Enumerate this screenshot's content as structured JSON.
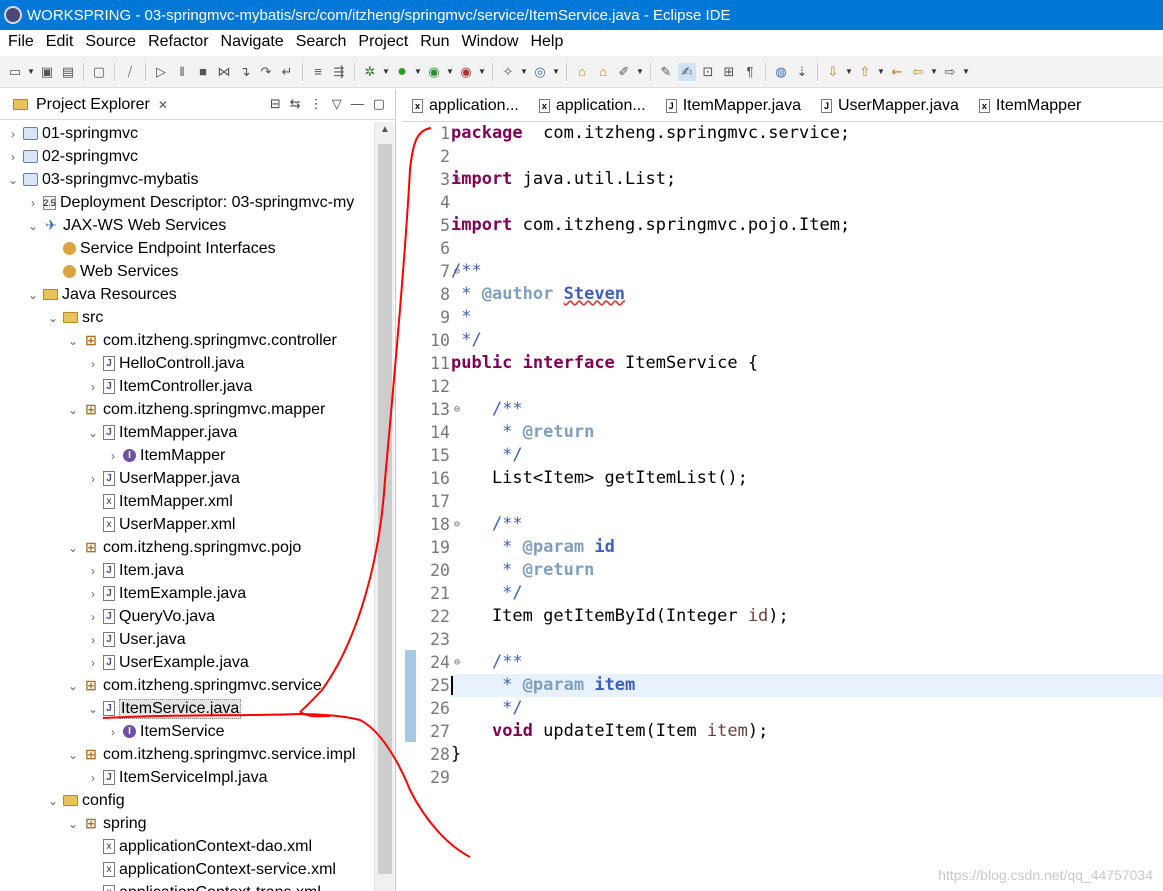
{
  "window": {
    "title": "WORKSPRING - 03-springmvc-mybatis/src/com/itzheng/springmvc/service/ItemService.java - Eclipse IDE"
  },
  "menubar": {
    "items": [
      "File",
      "Edit",
      "Source",
      "Refactor",
      "Navigate",
      "Search",
      "Project",
      "Run",
      "Window",
      "Help"
    ]
  },
  "project_explorer": {
    "title": "Project Explorer",
    "tree": [
      {
        "label": "01-springmvc",
        "icon": "project-icon",
        "twisty": "›",
        "indent": 0
      },
      {
        "label": "02-springmvc",
        "icon": "project-icon",
        "twisty": "›",
        "indent": 0
      },
      {
        "label": "03-springmvc-mybatis",
        "icon": "project-icon",
        "twisty": "⌄",
        "indent": 0
      },
      {
        "label": "Deployment Descriptor: 03-springmvc-my",
        "icon": "deployment-descriptor-icon",
        "twisty": "›",
        "indent": 1
      },
      {
        "label": "JAX-WS Web Services",
        "icon": "web-services-icon",
        "twisty": "⌄",
        "indent": 1
      },
      {
        "label": "Service Endpoint Interfaces",
        "icon": "endpoint-icon",
        "twisty": "",
        "indent": 2
      },
      {
        "label": "Web Services",
        "icon": "web-service-icon",
        "twisty": "",
        "indent": 2
      },
      {
        "label": "Java Resources",
        "icon": "java-resources-icon",
        "twisty": "⌄",
        "indent": 1
      },
      {
        "label": "src",
        "icon": "source-folder-icon",
        "twisty": "⌄",
        "indent": 2
      },
      {
        "label": "com.itzheng.springmvc.controller",
        "icon": "package-icon",
        "twisty": "⌄",
        "indent": 3
      },
      {
        "label": "HelloControll.java",
        "icon": "java-file-icon",
        "twisty": "›",
        "indent": 4
      },
      {
        "label": "ItemController.java",
        "icon": "java-file-icon",
        "twisty": "›",
        "indent": 4
      },
      {
        "label": "com.itzheng.springmvc.mapper",
        "icon": "package-icon",
        "twisty": "⌄",
        "indent": 3
      },
      {
        "label": "ItemMapper.java",
        "icon": "java-interface-file-icon",
        "twisty": "⌄",
        "indent": 4
      },
      {
        "label": "ItemMapper",
        "icon": "interface-icon",
        "twisty": "›",
        "indent": 5
      },
      {
        "label": "UserMapper.java",
        "icon": "java-interface-file-icon",
        "twisty": "›",
        "indent": 4
      },
      {
        "label": "ItemMapper.xml",
        "icon": "xml-file-icon",
        "twisty": "",
        "indent": 4
      },
      {
        "label": "UserMapper.xml",
        "icon": "xml-file-icon",
        "twisty": "",
        "indent": 4
      },
      {
        "label": "com.itzheng.springmvc.pojo",
        "icon": "package-icon",
        "twisty": "⌄",
        "indent": 3
      },
      {
        "label": "Item.java",
        "icon": "java-file-icon",
        "twisty": "›",
        "indent": 4
      },
      {
        "label": "ItemExample.java",
        "icon": "java-file-icon",
        "twisty": "›",
        "indent": 4
      },
      {
        "label": "QueryVo.java",
        "icon": "java-file-icon",
        "twisty": "›",
        "indent": 4
      },
      {
        "label": "User.java",
        "icon": "java-file-icon",
        "twisty": "›",
        "indent": 4
      },
      {
        "label": "UserExample.java",
        "icon": "java-file-icon",
        "twisty": "›",
        "indent": 4
      },
      {
        "label": "com.itzheng.springmvc.service",
        "icon": "package-icon",
        "twisty": "⌄",
        "indent": 3
      },
      {
        "label": "ItemService.java",
        "icon": "java-interface-file-icon",
        "twisty": "⌄",
        "indent": 4,
        "selected": true
      },
      {
        "label": "ItemService",
        "icon": "interface-icon",
        "twisty": "›",
        "indent": 5
      },
      {
        "label": "com.itzheng.springmvc.service.impl",
        "icon": "package-icon",
        "twisty": "⌄",
        "indent": 3
      },
      {
        "label": "ItemServiceImpl.java",
        "icon": "java-file-icon",
        "twisty": "›",
        "indent": 4
      },
      {
        "label": "config",
        "icon": "source-folder-icon",
        "twisty": "⌄",
        "indent": 2
      },
      {
        "label": "spring",
        "icon": "package-icon",
        "twisty": "⌄",
        "indent": 3
      },
      {
        "label": "applicationContext-dao.xml",
        "icon": "xml-file-icon",
        "twisty": "",
        "indent": 4
      },
      {
        "label": "applicationContext-service.xml",
        "icon": "xml-file-icon",
        "twisty": "",
        "indent": 4
      },
      {
        "label": "applicationContext-trans.xml",
        "icon": "xml-file-icon",
        "twisty": "",
        "indent": 4
      }
    ]
  },
  "editor": {
    "tabs": [
      {
        "label": "application...",
        "icon": "xml-file-icon"
      },
      {
        "label": "application...",
        "icon": "xml-file-icon"
      },
      {
        "label": "ItemMapper.java",
        "icon": "java-file-icon"
      },
      {
        "label": "UserMapper.java",
        "icon": "java-file-icon"
      },
      {
        "label": "ItemMapper",
        "icon": "xml-file-icon"
      }
    ],
    "lines": [
      {
        "n": "1",
        "fold": "",
        "seg": [
          [
            "kw",
            "package"
          ],
          [
            "",
            "  com.itzheng.springmvc.service;"
          ]
        ]
      },
      {
        "n": "2",
        "fold": "",
        "seg": []
      },
      {
        "n": "3",
        "fold": "⊖",
        "seg": [
          [
            "kw",
            "import"
          ],
          [
            "",
            " java.util.List;"
          ]
        ]
      },
      {
        "n": "4",
        "fold": "",
        "seg": []
      },
      {
        "n": "5",
        "fold": "",
        "seg": [
          [
            "kw",
            "import"
          ],
          [
            "",
            " com.itzheng.springmvc.pojo.Item;"
          ]
        ]
      },
      {
        "n": "6",
        "fold": "",
        "seg": []
      },
      {
        "n": "7",
        "fold": "⊖",
        "seg": [
          [
            "cm",
            "/**"
          ]
        ]
      },
      {
        "n": "8",
        "fold": "",
        "seg": [
          [
            "cm",
            " * "
          ],
          [
            "tag",
            "@author"
          ],
          [
            "cm",
            " "
          ],
          [
            "cmu",
            "Steven"
          ]
        ]
      },
      {
        "n": "9",
        "fold": "",
        "seg": [
          [
            "cm",
            " *"
          ]
        ]
      },
      {
        "n": "10",
        "fold": "",
        "seg": [
          [
            "cm",
            " */"
          ]
        ]
      },
      {
        "n": "11",
        "fold": "",
        "seg": [
          [
            "kw",
            "public"
          ],
          [
            "",
            " "
          ],
          [
            "kw",
            "interface"
          ],
          [
            "",
            " ItemService {"
          ]
        ]
      },
      {
        "n": "12",
        "fold": "",
        "seg": []
      },
      {
        "n": "13",
        "fold": "⊖",
        "seg": [
          [
            "",
            "    "
          ],
          [
            "cm",
            "/**"
          ]
        ]
      },
      {
        "n": "14",
        "fold": "",
        "seg": [
          [
            "cm",
            "     * "
          ],
          [
            "tag",
            "@return"
          ]
        ]
      },
      {
        "n": "15",
        "fold": "",
        "seg": [
          [
            "cm",
            "     */"
          ]
        ]
      },
      {
        "n": "16",
        "fold": "",
        "seg": [
          [
            "",
            "    List<Item> getItemList();"
          ]
        ]
      },
      {
        "n": "17",
        "fold": "",
        "seg": []
      },
      {
        "n": "18",
        "fold": "⊖",
        "seg": [
          [
            "",
            "    "
          ],
          [
            "cm",
            "/**"
          ]
        ]
      },
      {
        "n": "19",
        "fold": "",
        "seg": [
          [
            "cm",
            "     * "
          ],
          [
            "tag",
            "@param"
          ],
          [
            "cm",
            " "
          ],
          [
            "pname",
            "id"
          ]
        ]
      },
      {
        "n": "20",
        "fold": "",
        "seg": [
          [
            "cm",
            "     * "
          ],
          [
            "tag",
            "@return"
          ]
        ]
      },
      {
        "n": "21",
        "fold": "",
        "seg": [
          [
            "cm",
            "     */"
          ]
        ]
      },
      {
        "n": "22",
        "fold": "",
        "seg": [
          [
            "",
            "    Item getItemById(Integer "
          ],
          [
            "var",
            "id"
          ],
          [
            "",
            ");"
          ]
        ]
      },
      {
        "n": "23",
        "fold": "",
        "seg": []
      },
      {
        "n": "24",
        "fold": "⊖",
        "seg": [
          [
            "",
            "    "
          ],
          [
            "cm",
            "/**"
          ]
        ]
      },
      {
        "n": "25",
        "fold": "",
        "seg": [
          [
            "cm",
            "     * "
          ],
          [
            "tag",
            "@param"
          ],
          [
            "cm",
            " "
          ],
          [
            "pname",
            "item"
          ]
        ],
        "current": true
      },
      {
        "n": "26",
        "fold": "",
        "seg": [
          [
            "cm",
            "     */"
          ]
        ]
      },
      {
        "n": "27",
        "fold": "",
        "seg": [
          [
            "",
            "    "
          ],
          [
            "kw",
            "void"
          ],
          [
            "",
            " updateItem(Item "
          ],
          [
            "var",
            "item"
          ],
          [
            "",
            ");"
          ]
        ]
      },
      {
        "n": "28",
        "fold": "",
        "seg": [
          [
            "",
            "}"
          ]
        ]
      },
      {
        "n": "29",
        "fold": "",
        "seg": []
      }
    ]
  },
  "watermark": "https://blog.csdn.net/qq_44757034",
  "colors": {
    "titlebar": "#0078d7",
    "keyword": "#7f0055",
    "comment": "#3f5fbf",
    "annotation": "#ff0000"
  }
}
